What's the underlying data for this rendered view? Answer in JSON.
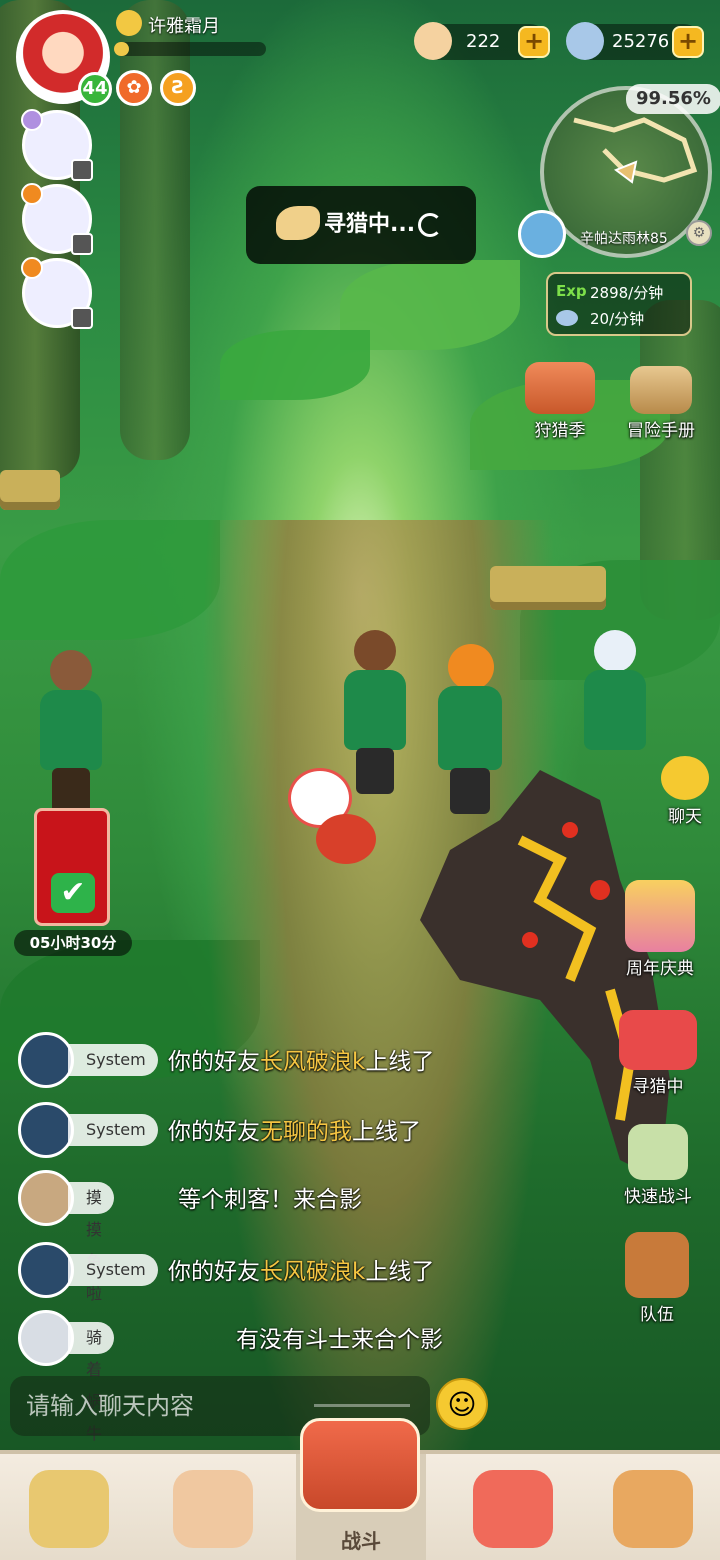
{
  "player": {
    "name": "许雅霜月",
    "level": "44",
    "xp_fraction": 0.1
  },
  "buffs": [
    {
      "icon": "buff-orange-icon",
      "color": "#f06a2a"
    },
    {
      "icon": "buff-spiral-icon",
      "color": "#f5a020"
    }
  ],
  "currencies": [
    {
      "name": "shell",
      "value": "222",
      "plus": "+"
    },
    {
      "name": "gem",
      "value": "25276",
      "plus": "+"
    }
  ],
  "minimap": {
    "exploration": "99.56%",
    "location": "辛帕达雨林85",
    "gear": "⚙"
  },
  "rates": {
    "exp_label": "Exp",
    "exp_rate": "2898/分钟",
    "gem_rate": "20/分钟"
  },
  "status": {
    "searching": "寻猎中..."
  },
  "side_buttons": {
    "hunt_season": "狩猎季",
    "adventure_manual": "冒险手册",
    "chat": "聊天",
    "anniversary": "周年庆典",
    "hunting": "寻猎中",
    "quick_battle": "快速战斗",
    "team": "队伍"
  },
  "redpack": {
    "timer": "05小时30分",
    "check": "✔"
  },
  "chat": {
    "messages": [
      {
        "sender": "System",
        "prefix": "你的好友",
        "highlight": "长风破浪k",
        "suffix": "上线了"
      },
      {
        "sender": "System",
        "prefix": "你的好友",
        "highlight": "无聊的我",
        "suffix": "上线了"
      },
      {
        "sender": "摸摸鱼啦",
        "prefix": "等个刺客！来合影",
        "highlight": "",
        "suffix": ""
      },
      {
        "sender": "System",
        "prefix": "你的好友",
        "highlight": "长风破浪k",
        "suffix": "上线了"
      },
      {
        "sender": "骑着蜗牛追火箭",
        "prefix": "有没有斗士来合个影",
        "highlight": "",
        "suffix": ""
      }
    ],
    "input_placeholder": "请输入聊天内容",
    "emoji": "☺"
  },
  "bottom_nav": {
    "battle_label": "战斗"
  },
  "colors": {
    "accent_gold": "#f5c542",
    "battle_red": "#c8482a"
  }
}
